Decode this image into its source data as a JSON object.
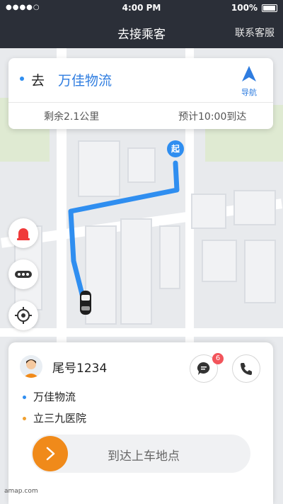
{
  "status_bar": {
    "signal": "●●●●○",
    "time": "4:00 PM",
    "battery": "100%"
  },
  "nav": {
    "title": "去接乘客",
    "service": "联系客服"
  },
  "destination": {
    "prefix": "去",
    "name": "万佳物流",
    "navigate": "导航",
    "remaining": "剩余2.1公里",
    "eta": "预计10:00到达"
  },
  "map": {
    "start_label": "起",
    "attribution": "amap.com"
  },
  "passenger": {
    "tail_number": "尾号1234",
    "unread_messages": "6",
    "pickup": "万佳物流",
    "dropoff": "立三九医院",
    "slider_text": "到达上车地点"
  },
  "colors": {
    "route": "#2f8ef0",
    "accent_orange": "#f08a1a",
    "pickup_dot": "#2f8ef0",
    "dropoff_dot": "#f0a030"
  }
}
